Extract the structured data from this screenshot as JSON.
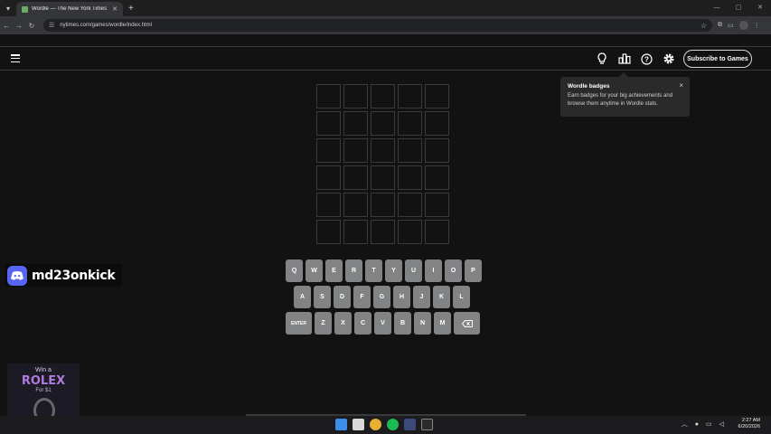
{
  "browser": {
    "tab_title": "Wordle — The New York Times",
    "url": "nytimes.com/games/wordle/index.html"
  },
  "header": {
    "subscribe_label": "Subscribe to Games",
    "icons": [
      "menu-icon",
      "lightbulb-icon",
      "stats-icon",
      "help-icon",
      "gear-icon"
    ]
  },
  "tooltip": {
    "title": "Wordle badges",
    "body": "Earn badges for your big achievements and browse them anytime in Wordle stats.",
    "close": "×"
  },
  "board": {
    "rows": 6,
    "cols": 5
  },
  "keyboard": {
    "row1": [
      "Q",
      "W",
      "E",
      "R",
      "T",
      "Y",
      "U",
      "I",
      "O",
      "P"
    ],
    "row2": [
      "A",
      "S",
      "D",
      "F",
      "G",
      "H",
      "J",
      "K",
      "L"
    ],
    "row3_enter": "ENTER",
    "row3": [
      "Z",
      "X",
      "C",
      "V",
      "B",
      "N",
      "M"
    ]
  },
  "overlay": {
    "discord_name": "md23onkick",
    "ad_line1": "Win a",
    "ad_line2": "ROLEX",
    "ad_line3": "For $1"
  },
  "taskbar": {
    "time": "2:27 AM",
    "date": "6/20/2026"
  },
  "colors": {
    "background": "#121213",
    "key": "#818384",
    "tile_border": "#3a3a3c"
  }
}
